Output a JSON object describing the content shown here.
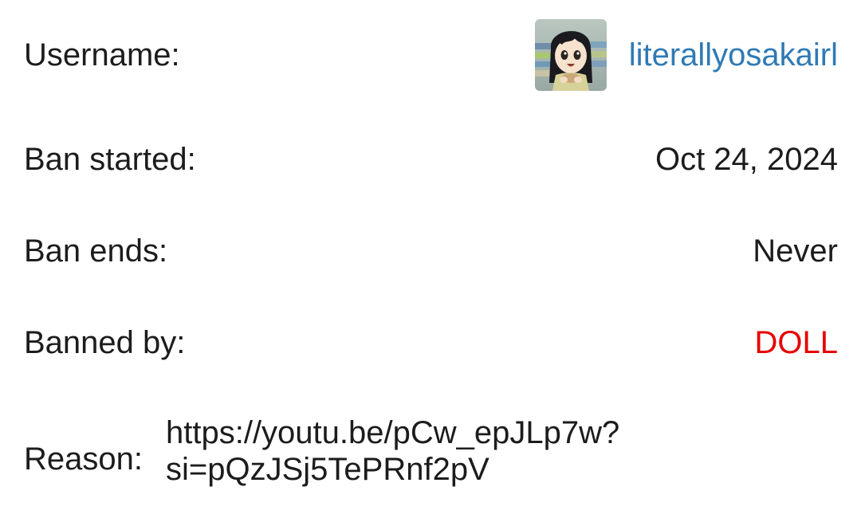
{
  "colors": {
    "text": "#1c1c1c",
    "link": "#2f7ab5",
    "banned_by": "#e60000",
    "background": "#ffffff"
  },
  "username": {
    "label": "Username:",
    "avatar_icon": "anime-girl-avatar",
    "value": "literallyosakairl"
  },
  "ban_started": {
    "label": "Ban started:",
    "value": "Oct 24, 2024"
  },
  "ban_ends": {
    "label": "Ban ends:",
    "value": "Never"
  },
  "banned_by": {
    "label": "Banned by:",
    "value": "DOLL"
  },
  "reason": {
    "label": "Reason:",
    "line1": "https://youtu.be/pCw_epJLp7w?",
    "line2": "si=pQzJSj5TePRnf2pV"
  }
}
